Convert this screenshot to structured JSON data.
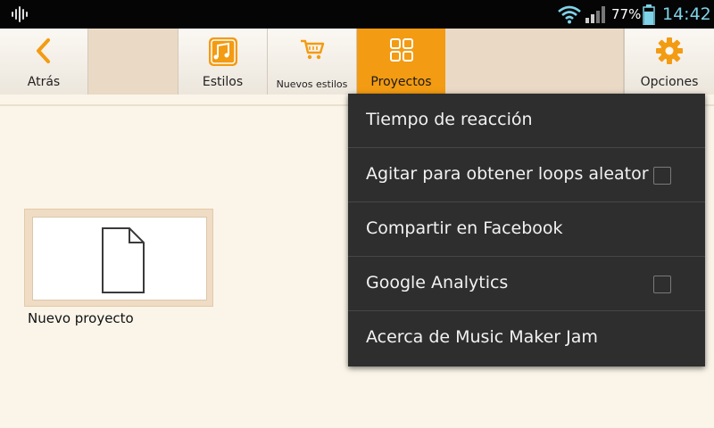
{
  "status_bar": {
    "battery_percent": "77%",
    "battery_level": 0.77,
    "time": "14:42",
    "icons": [
      "sound-wave-icon",
      "wifi-icon",
      "signal-icon",
      "battery-icon"
    ]
  },
  "toolbar": {
    "back_label": "Atrás",
    "styles_label": "Estilos",
    "new_styles_label": "Nuevos estilos",
    "projects_label": "Proyectos",
    "options_label": "Opciones",
    "active_tab": "Proyectos",
    "icons": [
      "chevron-left-icon",
      "music-notes-icon",
      "shopping-cart-icon",
      "grid-icon",
      "gear-icon"
    ]
  },
  "project": {
    "label": "Nuevo proyecto",
    "icon": "document-icon"
  },
  "menu": {
    "items": [
      {
        "label": "Tiempo de reacción",
        "has_checkbox": false
      },
      {
        "label": "Agitar para obtener loops aleatorios",
        "has_checkbox": true,
        "checked": false
      },
      {
        "label": "Compartir en Facebook",
        "has_checkbox": false
      },
      {
        "label": "Google Analytics",
        "has_checkbox": true,
        "checked": false
      },
      {
        "label": "Acerca de Music Maker Jam",
        "has_checkbox": false
      }
    ]
  },
  "colors": {
    "accent": "#f39b12",
    "background": "#fbf5e9",
    "menu_background": "#2e2e2e",
    "status_accent": "#7fd3e8"
  }
}
